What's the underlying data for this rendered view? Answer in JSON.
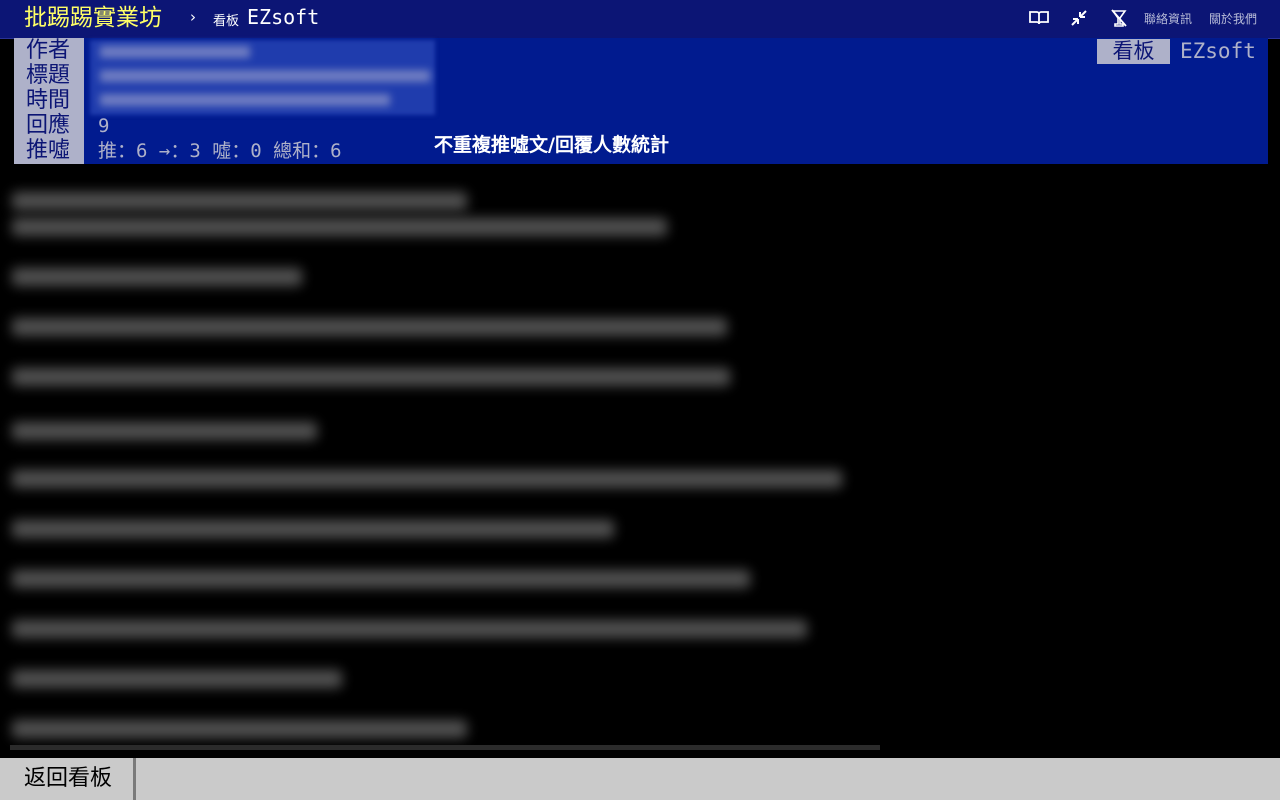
{
  "topbar": {
    "site_title": "批踢踢實業坊",
    "breadcrumb_arrow": "›",
    "breadcrumb_label": "看板",
    "board_name": "EZsoft",
    "icons": [
      "book-icon",
      "collapse-icon",
      "no-drinks-icon"
    ],
    "links": {
      "contact": "聯絡資訊",
      "about": "關於我們"
    }
  },
  "article": {
    "labels": {
      "author": "作者",
      "title": "標題",
      "time": "時間",
      "replies": "回應",
      "pushes": "推噓"
    },
    "replies_count": "9",
    "push_stats": "推：6 →：3 噓：0 總和：6",
    "dedupe_link": "不重複推噓文/回覆人數統計",
    "board_tag_label": "看板",
    "board_tag_name": "EZsoft"
  },
  "colors": {
    "topbar_bg": "#0c1575",
    "header_bg": "#011b8f",
    "label_bg": "#aeb1c9",
    "site_title": "#ffff66",
    "bottombar_bg": "#cacaca"
  },
  "footer": {
    "back_label": "返回看板"
  }
}
